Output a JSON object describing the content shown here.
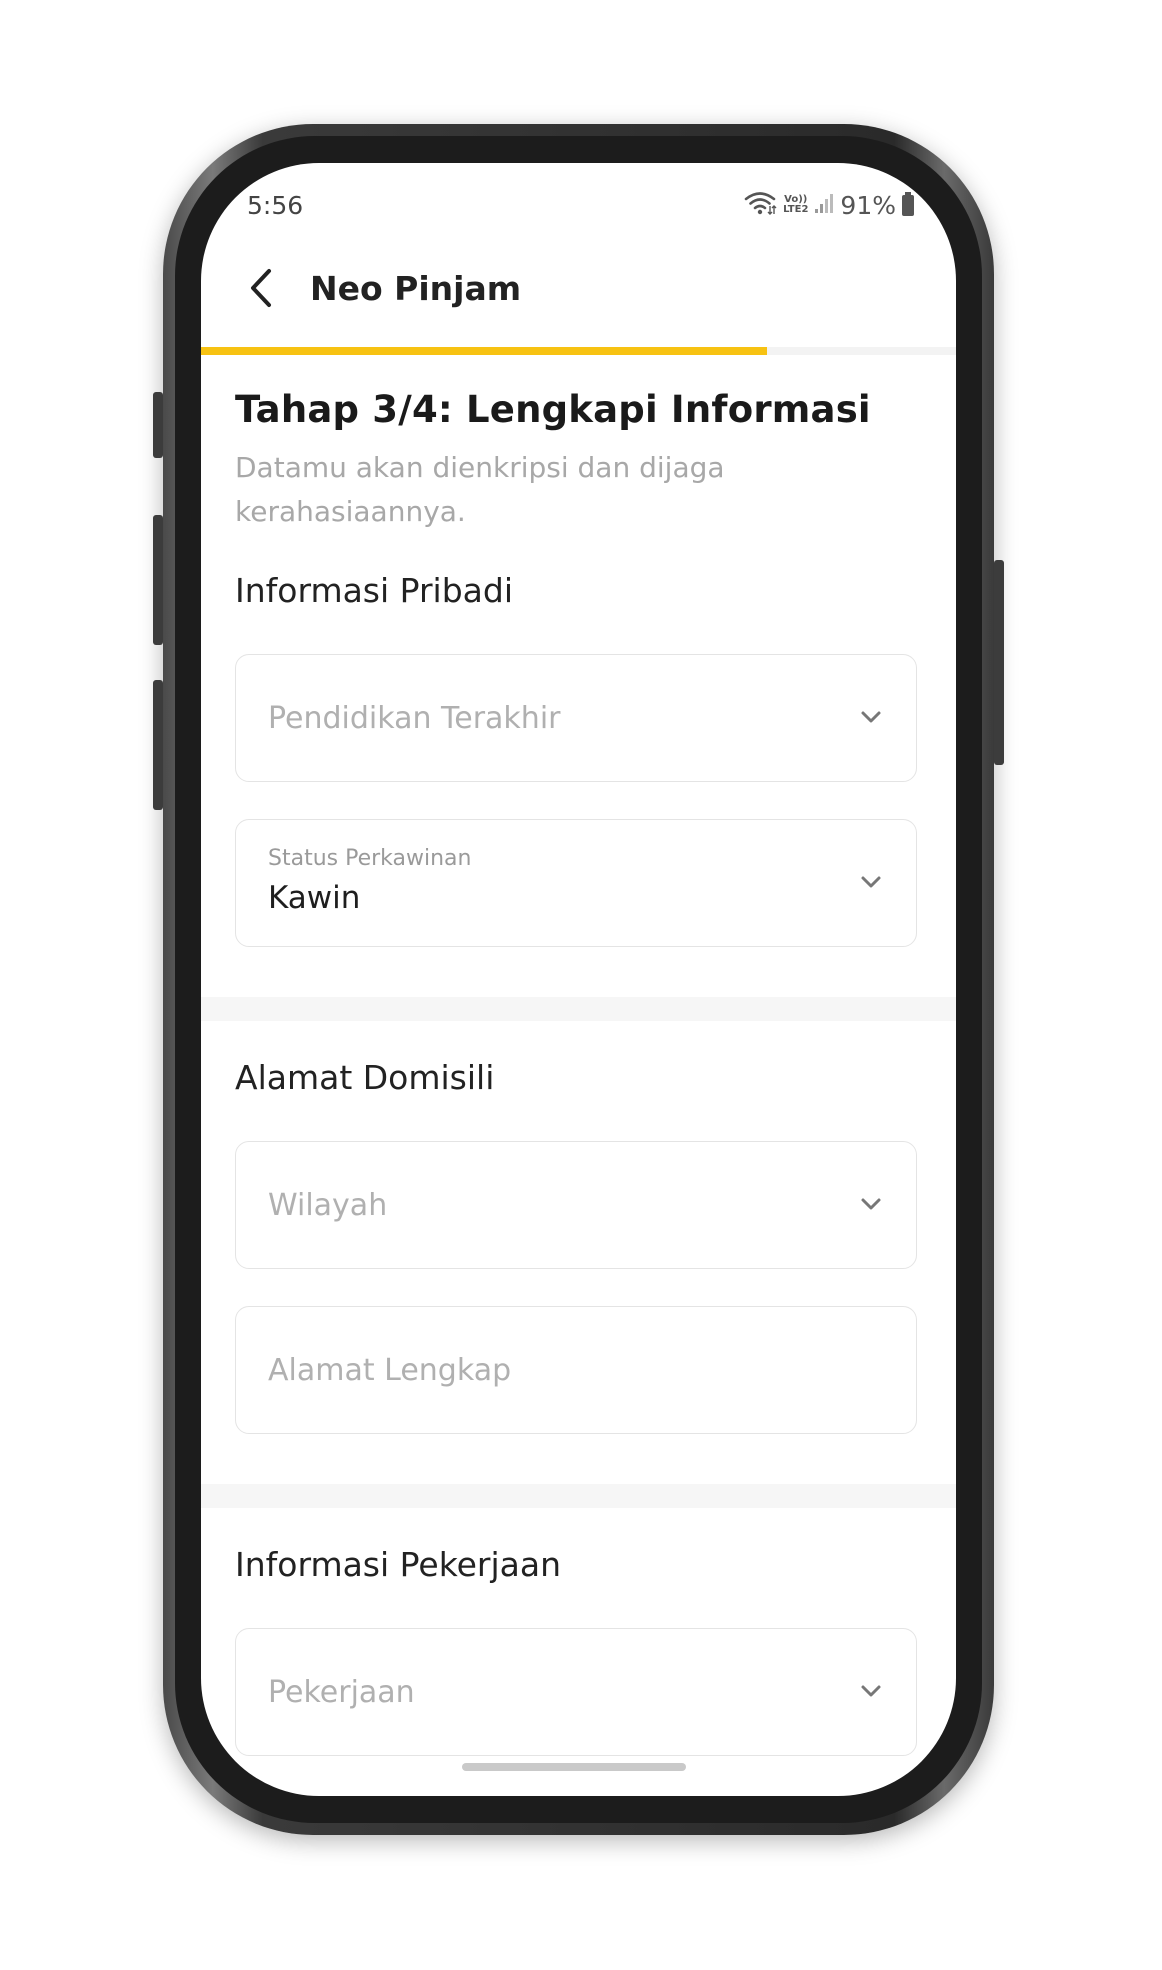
{
  "status_bar": {
    "time": "5:56",
    "network_top": "Vo))",
    "network_bottom": "LTE2",
    "battery": "91%"
  },
  "header": {
    "title": "Neo Pinjam"
  },
  "progress": {
    "fraction": 0.75,
    "color": "#f7c212"
  },
  "step": {
    "title": "Tahap 3/4: Lengkapi Informasi",
    "subtitle": "Datamu akan dienkripsi dan dijaga kerahasiaannya."
  },
  "sections": {
    "personal": {
      "title": "Informasi Pribadi",
      "education_placeholder": "Pendidikan Terakhir",
      "marital_label": "Status Perkawinan",
      "marital_value": "Kawin"
    },
    "address": {
      "title": "Alamat Domisili",
      "region_placeholder": "Wilayah",
      "full_address_placeholder": "Alamat Lengkap"
    },
    "job": {
      "title": "Informasi Pekerjaan",
      "job_placeholder": "Pekerjaan"
    }
  },
  "icons": {
    "back": "chevron-left-icon",
    "dropdown": "chevron-down-icon",
    "wifi": "wifi-icon",
    "signal": "signal-icon",
    "battery": "battery-icon"
  }
}
